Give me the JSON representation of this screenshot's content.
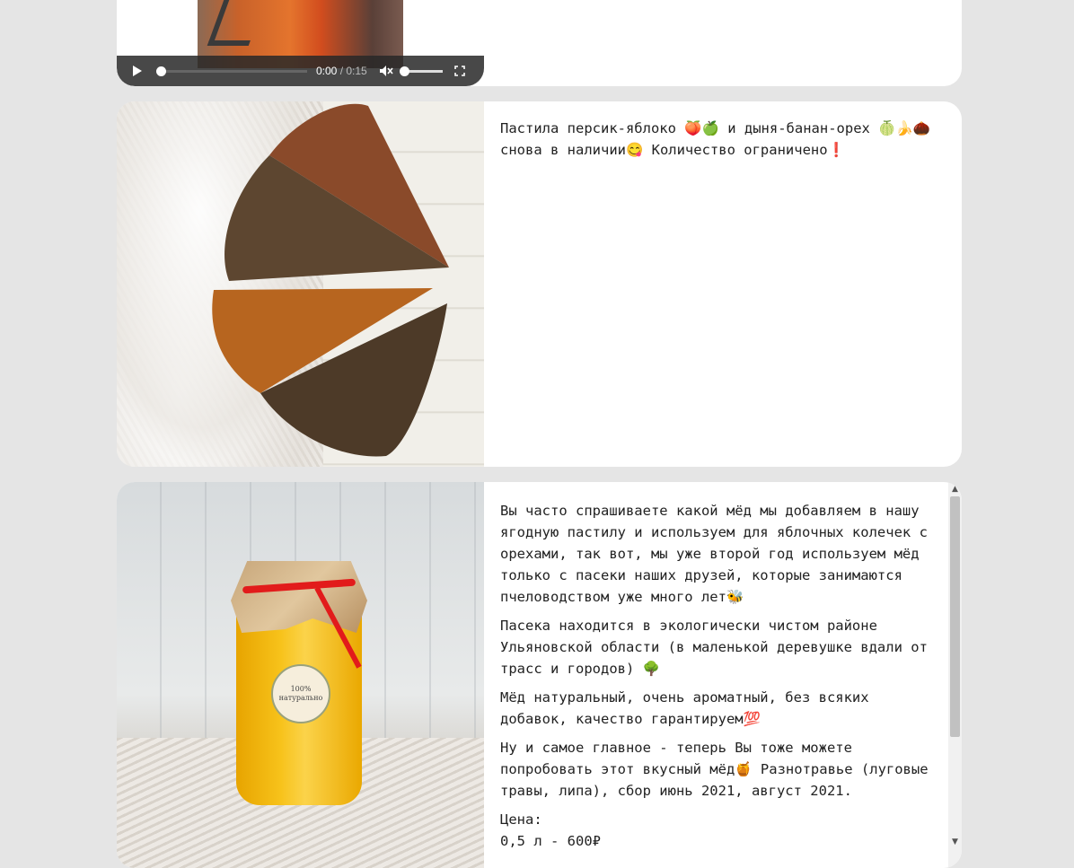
{
  "video": {
    "time_current": "0:00",
    "time_separator": " / ",
    "time_duration": "0:15",
    "progress": 0,
    "volume": 1,
    "icons": {
      "play": "play-icon",
      "mute": "speaker-muted-icon",
      "fullscreen": "fullscreen-icon"
    }
  },
  "posts": [
    {
      "paragraphs": [
        "Пастила персик-яблоко 🍑🍏 и дыня-банан-орех 🍈🍌🌰 снова в наличии😋 Количество ограничено❗"
      ]
    },
    {
      "sticker_text": "100% натурально",
      "paragraphs": [
        "Вы часто спрашиваете какой мёд мы добавляем в нашу ягодную пастилу и используем для яблочных колечек с орехами, так вот, мы уже второй год используем мёд только с пасеки наших друзей, которые занимаются пчеловодством уже много лет🐝",
        "Пасека находится в экологически чистом районе Ульяновской области (в маленькой деревушке вдали от трасс и городов) 🌳",
        "Мёд натуральный, очень ароматный, без всяких добавок, качество гарантируем💯",
        "Ну и самое главное - теперь Вы тоже можете попробовать этот вкусный мёд🍯 Разнотравье (луговые травы, липа), сбор июнь 2021, август 2021.",
        "Цена:",
        "0,5 л - 600₽"
      ]
    }
  ],
  "colors": {
    "background": "#e5e5e5",
    "card": "#ffffff",
    "ribbon": "#e21b1b",
    "honey": "#f7c21a"
  }
}
